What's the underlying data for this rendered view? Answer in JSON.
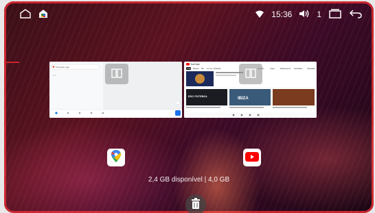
{
  "status_bar": {
    "left_icons": [
      "home-icon",
      "app-store-icon"
    ],
    "time": "15:36",
    "volume_level": "1",
    "right_icons": [
      "wifi-icon",
      "speaker-icon",
      "recent-apps-icon",
      "back-icon"
    ]
  },
  "recent_apps": [
    {
      "app": "Google Maps",
      "icon": "google-maps-icon",
      "split_icon": "split-screen-icon",
      "preview": {
        "search_placeholder": "Pesquisar aqui"
      }
    },
    {
      "app": "YouTube",
      "icon": "youtube-icon",
      "split_icon": "split-screen-icon",
      "preview": {
        "logo_text": "YouTube",
        "chips": [
          "Tudo",
          "Música",
          "Mix",
          "Ao vivo",
          "Podcasts",
          "Notícias",
          "Jogos",
          "Relaxamento",
          "Novidades",
          "Assistidos"
        ],
        "thumbnail_titles": [
          "ESC FUTEBOL",
          "IBIZA"
        ]
      }
    }
  ],
  "storage_text": "2,4 GB disponível | 4,0 GB",
  "colors": {
    "accent_red": "#c8252d",
    "youtube_red": "#ff0000"
  }
}
